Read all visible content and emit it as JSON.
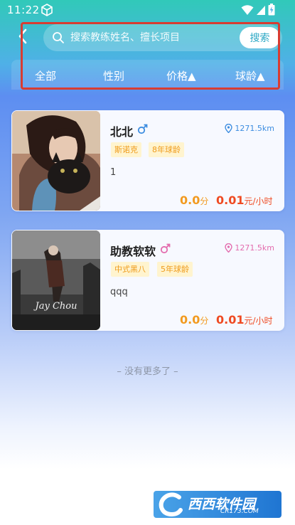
{
  "status_bar": {
    "time": "11:22"
  },
  "search": {
    "placeholder": "搜索教练姓名、擅长项目",
    "value": "",
    "button_label": "搜索"
  },
  "filters": [
    {
      "label": "全部"
    },
    {
      "label": "性别"
    },
    {
      "label": "价格▲"
    },
    {
      "label": "球龄▲"
    }
  ],
  "coaches": [
    {
      "name": "北北",
      "gender": "male",
      "distance": "1271.5km",
      "tags": [
        "斯诺克",
        "8年球龄"
      ],
      "description": "1",
      "score": "0.0",
      "score_unit": "分",
      "price": "0.01",
      "price_unit": "元/小时"
    },
    {
      "name": "助教软软",
      "gender": "female",
      "distance": "1271.5km",
      "tags": [
        "中式黑八",
        "5年球龄"
      ],
      "description": "qqq",
      "score": "0.0",
      "score_unit": "分",
      "price": "0.01",
      "price_unit": "元/小时"
    }
  ],
  "list_end_text": "– 没有更多了 –",
  "watermark": {
    "logo_text": "西西软件园",
    "url": "CR173.COM"
  },
  "colors": {
    "accent": "#2ea9c6",
    "male": "#3d8de0",
    "female": "#e36cae",
    "tag_bg": "#fff4cf",
    "tag_text": "#ef9b1b",
    "price": "#ef4a22",
    "score": "#f29a1f",
    "highlight_frame": "#d83c32"
  }
}
